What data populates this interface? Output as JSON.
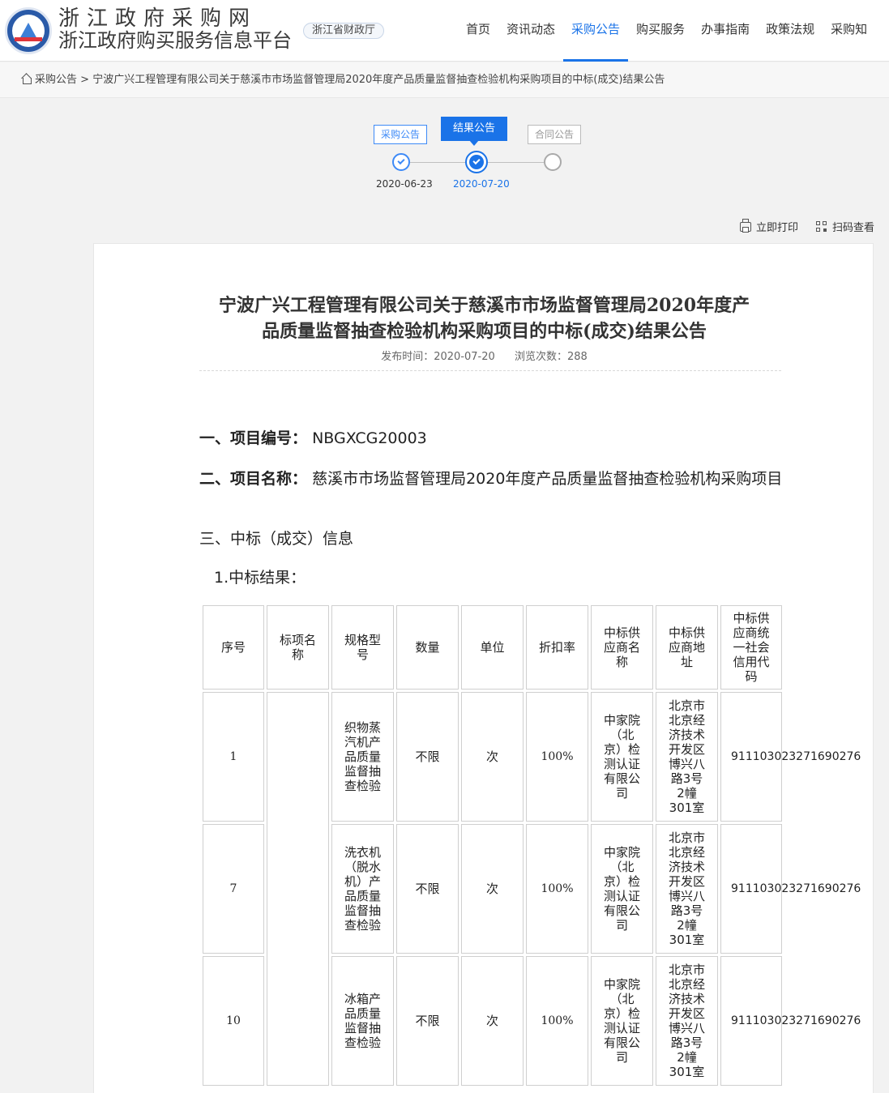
{
  "header": {
    "title": "浙江政府采购网",
    "subtitle": "浙江政府购买服务信息平台",
    "dept": "浙江省财政厅",
    "nav": [
      {
        "label": "首页"
      },
      {
        "label": "资讯动态"
      },
      {
        "label": "采购公告"
      },
      {
        "label": "购买服务"
      },
      {
        "label": "办事指南"
      },
      {
        "label": "政策法规"
      },
      {
        "label": "采购知"
      }
    ]
  },
  "breadcrumb": {
    "root": "采购公告",
    "separator": ">",
    "current": "宁波广兴工程管理有限公司关于慈溪市市场监督管理局2020年度产品质量监督抽查检验机构采购项目的中标(成交)结果公告"
  },
  "steps": [
    {
      "label": "采购公告",
      "date": "2020-06-23",
      "state": "done"
    },
    {
      "label": "结果公告",
      "date": "2020-07-20",
      "state": "current"
    },
    {
      "label": "合同公告",
      "date": "",
      "state": "pending"
    }
  ],
  "tools": {
    "print": "立即打印",
    "scan": "扫码查看"
  },
  "doc": {
    "title_line1": "宁波广兴工程管理有限公司关于慈溪市市场监督管理局2020年度产",
    "title_line2": "品质量监督抽查检验机构采购项目的中标(成交)结果公告",
    "publish_label": "发布时间：",
    "publish_time": "2020-07-20",
    "views_label": "浏览次数：",
    "views": "288",
    "sec1_label": "一、项目编号：",
    "sec1_value": "NBGXCG20003",
    "sec2_label": "二、项目名称：",
    "sec2_value": "慈溪市市场监督管理局2020年度产品质量监督抽查检验机构采购项目",
    "sec3": "三、中标（成交）信息",
    "sub1": "1.中标结果："
  },
  "table": {
    "headers": [
      "序号",
      "标项名称",
      "规格型号",
      "数量",
      "单位",
      "折扣率",
      "中标供应商名称",
      "中标供应商地址",
      "中标供应商统一社会信用代码"
    ],
    "rows": [
      {
        "no": "1",
        "name": "",
        "spec": "织物蒸汽机产品质量监督抽查检验",
        "qty": "不限",
        "unit": "次",
        "discount": "100%",
        "supplier": "中家院（北京）检测认证有限公司",
        "address": "北京市北京经济技术开发区博兴八路3号2幢301室",
        "code": "911103023271690276"
      },
      {
        "no": "7",
        "name": "",
        "spec": "洗衣机（脱水机）产品质量监督抽查检验",
        "qty": "不限",
        "unit": "次",
        "discount": "100%",
        "supplier": "中家院（北京）检测认证有限公司",
        "address": "北京市北京经济技术开发区博兴八路3号2幢301室",
        "code": "911103023271690276"
      },
      {
        "no": "10",
        "name": "",
        "spec": "冰箱产品质量监督抽查检验",
        "qty": "不限",
        "unit": "次",
        "discount": "100%",
        "supplier": "中家院（北京）检测认证有限公司",
        "address": "北京市北京经济技术开发区博兴八路3号2幢301室",
        "code": "911103023271690276"
      }
    ]
  }
}
